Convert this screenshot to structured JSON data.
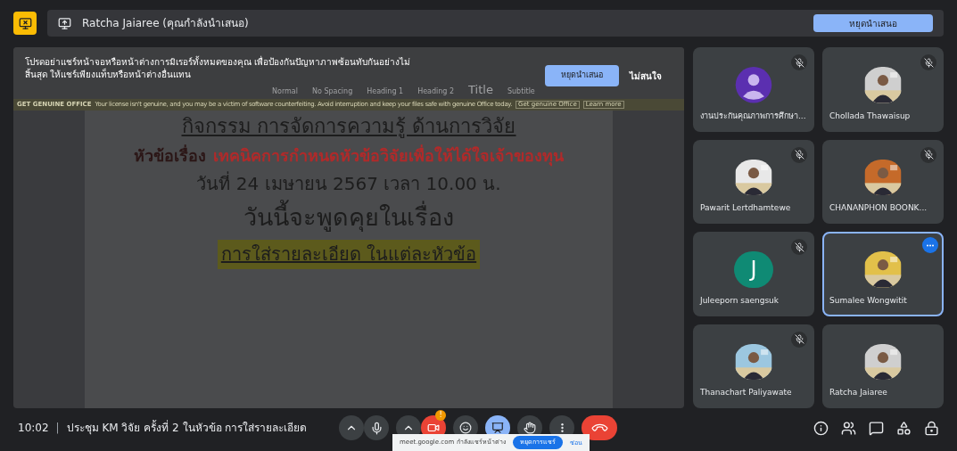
{
  "top_bar": {
    "presenter": "Ratcha Jaiaree (คุณกำลังนำเสนอ)",
    "stop_button": "หยุดนำเสนอ"
  },
  "shared_window": {
    "ribbon_styles": [
      "Normal",
      "No Spacing",
      "Heading 1",
      "Heading 2",
      "Title",
      "Subtitle"
    ],
    "notice": {
      "title": "GET GENUINE OFFICE",
      "text": "Your license isn't genuine, and you may be a victim of software counterfeiting. Avoid interruption and keep your files safe with genuine Office today.",
      "buttons": [
        "Get genuine Office",
        "Learn more"
      ]
    },
    "warning": {
      "text": "โปรดอย่าแชร์หน้าจอหรือหน้าต่างการมิเรอร์ทั้งหมดของคุณ เพื่อป้องกันปัญหาภาพซ้อนทับกันอย่างไม่สิ้นสุด ให้แชร์เพียงแท็บหรือหน้าต่างอื่นแทน",
      "stop_button": "หยุดนำเสนอ",
      "dismiss": "ไม่สนใจ"
    },
    "document": {
      "heading": "กิจกรรม การจัดการความรู้ ด้านการวิจัย",
      "topic_label": "หัวข้อเรื่อง",
      "topic": "เทคนิคการกำหนดหัวข้อวิจัยเพื่อให้ได้ใจเจ้าของทุน",
      "date": "วันที่ 24 เมษายน 2567 เวลา 10.00 น.",
      "today": "วันนี้จะพูดคุยในเรื่อง",
      "highlight": "การใส่รายละเอียด ในแต่ละหัวข้อ"
    }
  },
  "participants": [
    {
      "name": "งานประกันคุณภาพการศึกษา...",
      "kind": "person",
      "muted": true,
      "active": false
    },
    {
      "name": "Chollada Thawaisup",
      "muted": true,
      "active": false
    },
    {
      "name": "Pawarit Lertdhamtewe",
      "muted": true,
      "active": false
    },
    {
      "name": "CHANANPHON BOONK...",
      "muted": true,
      "active": false
    },
    {
      "name": "Juleeporn saengsuk",
      "kind": "letter",
      "letter": "J",
      "muted": true,
      "active": false
    },
    {
      "name": "Sumalee Wongwitit",
      "muted": false,
      "active": true
    },
    {
      "name": "Thanachart Paliyawate",
      "muted": true,
      "active": false
    },
    {
      "name": "Ratcha Jaiaree",
      "muted": false,
      "active": false
    }
  ],
  "bottom_bar": {
    "time": "10:02",
    "separator": "|",
    "meeting_title": "ประชุม KM วิจัย ครั้งที่ 2 ในหัวข้อ การใส่รายละเอียด",
    "alert_badge": "!",
    "share_popup": {
      "text": "meet.google.com กำลังแชร์หน้าต่าง",
      "stop_button": "หยุดการแชร์",
      "hide": "ซ่อน"
    }
  }
}
